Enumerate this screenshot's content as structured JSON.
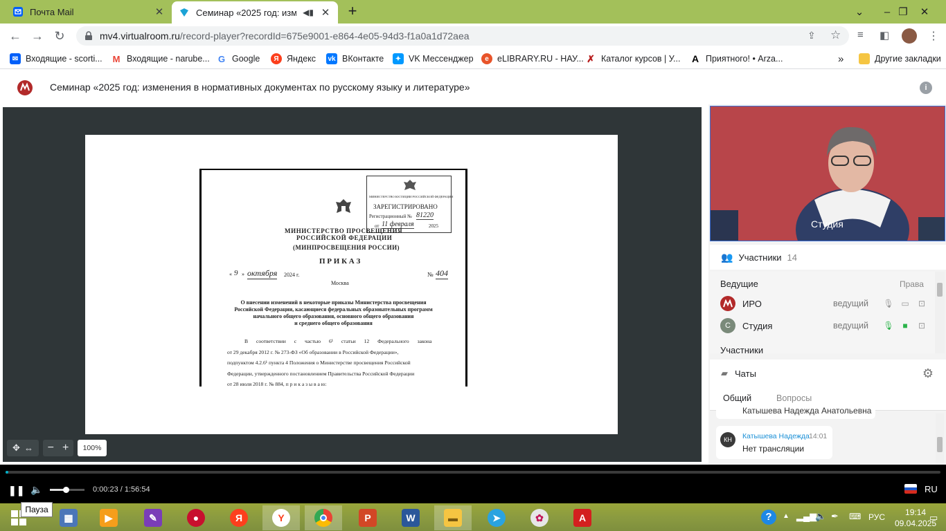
{
  "browser": {
    "tabs": [
      {
        "title": "Почта Mail"
      },
      {
        "title": "Семинар «2025 год: измене"
      }
    ],
    "url_host": "mv4.virtualroom.ru",
    "url_path": "/record-player?recordId=675e9001-e864-4e05-94d3-f1a0a1d72aea",
    "bookmarks": [
      "Входящие - scorti...",
      "Входящие - narube...",
      "Google",
      "Яндекс",
      "ВКонтакте",
      "VK Мессенджер",
      "eLIBRARY.RU - НАУ...",
      "Каталог курсов | У...",
      "Приятного! • Arza..."
    ],
    "more_bookmarks": "»",
    "other_bookmarks": "Другие закладки"
  },
  "app": {
    "title": "Семинар «2025 год: изменения в нормативных документах по русскому языку и литературе»"
  },
  "document": {
    "stamp_ministry": "МИНИСТЕРСТВО ЮСТИЦИИ РОССИЙСКОЙ ФЕДЕРАЦИИ",
    "stamp_registered": "ЗАРЕГИСТРИРОВАНО",
    "stamp_regnum_label": "Регистрационный №",
    "stamp_regnum": "81220",
    "stamp_from": "от",
    "stamp_date": "11 февраля",
    "stamp_year": "2025",
    "ministry_line1": "МИНИСТЕРСТВО ПРОСВЕЩЕНИЯ",
    "ministry_line2": "РОССИЙСКОЙ ФЕДЕРАЦИИ",
    "ministry_short": "(МИНПРОСВЕЩЕНИЯ РОССИИ)",
    "order": "П Р И К А З",
    "date_day": "9",
    "date_month": "октября",
    "date_year": "2024 г.",
    "number_label": "№",
    "number": "404",
    "city": "Москва",
    "heading_lines": [
      "О внесении изменений в некоторые приказы Министерства просвещения",
      "Российской Федерации, касающиеся федеральных образовательных программ",
      "начального общего образования, основного общего образования",
      "и среднего общего образования"
    ],
    "body_lines": [
      "В соответствии с частью 6¹ статьи 12 Федерального закона",
      "от 29 декабря 2012 г. № 273-ФЗ «Об образовании в Российской Федерации»,",
      "подпунктом 4.2.6¹ пункта 4 Положения о Министерстве просвещения Российской",
      "Федерации, утвержденного постановлением Правительства Российской Федерации",
      "от 28 июля 2018 г. № 884, п р и к а з ы в а ю:"
    ]
  },
  "stage": {
    "zoom": "100%",
    "zoom_minus": "−",
    "zoom_plus": "+"
  },
  "video": {
    "label": "Студия"
  },
  "participants": {
    "title": "Участники",
    "count": "14",
    "hosts_label": "Ведущие",
    "rights_label": "Права",
    "members_label": "Участники",
    "rows": [
      {
        "name": "ИРО",
        "role": "ведущий",
        "avatar": ""
      },
      {
        "name": "Студия",
        "role": "ведущий",
        "avatar": "С"
      }
    ]
  },
  "chat": {
    "title": "Чаты",
    "tabs": [
      "Общий",
      "Вопросы"
    ],
    "prev_author": "Катышева Надежда Анатольевна",
    "message": {
      "initials": "КН",
      "author": "Катышева Надежда",
      "time": "14:01",
      "text": "Нет трансляции"
    }
  },
  "player": {
    "time": "0:00:23 / 1:56:54",
    "progress_fraction": 0.003,
    "volume_fraction": 0.45,
    "tooltip": "Пауза",
    "lang": "RU"
  },
  "taskbar": {
    "lang": "РУС",
    "time": "19:14",
    "date": "09.04.2025"
  },
  "colors": {
    "chrome_frame": "#a3c05a",
    "stage_bg": "#2f3638",
    "progress": "#00b0c8",
    "video_bg": "#b8454a",
    "chat_author": "#1a8fd6"
  }
}
